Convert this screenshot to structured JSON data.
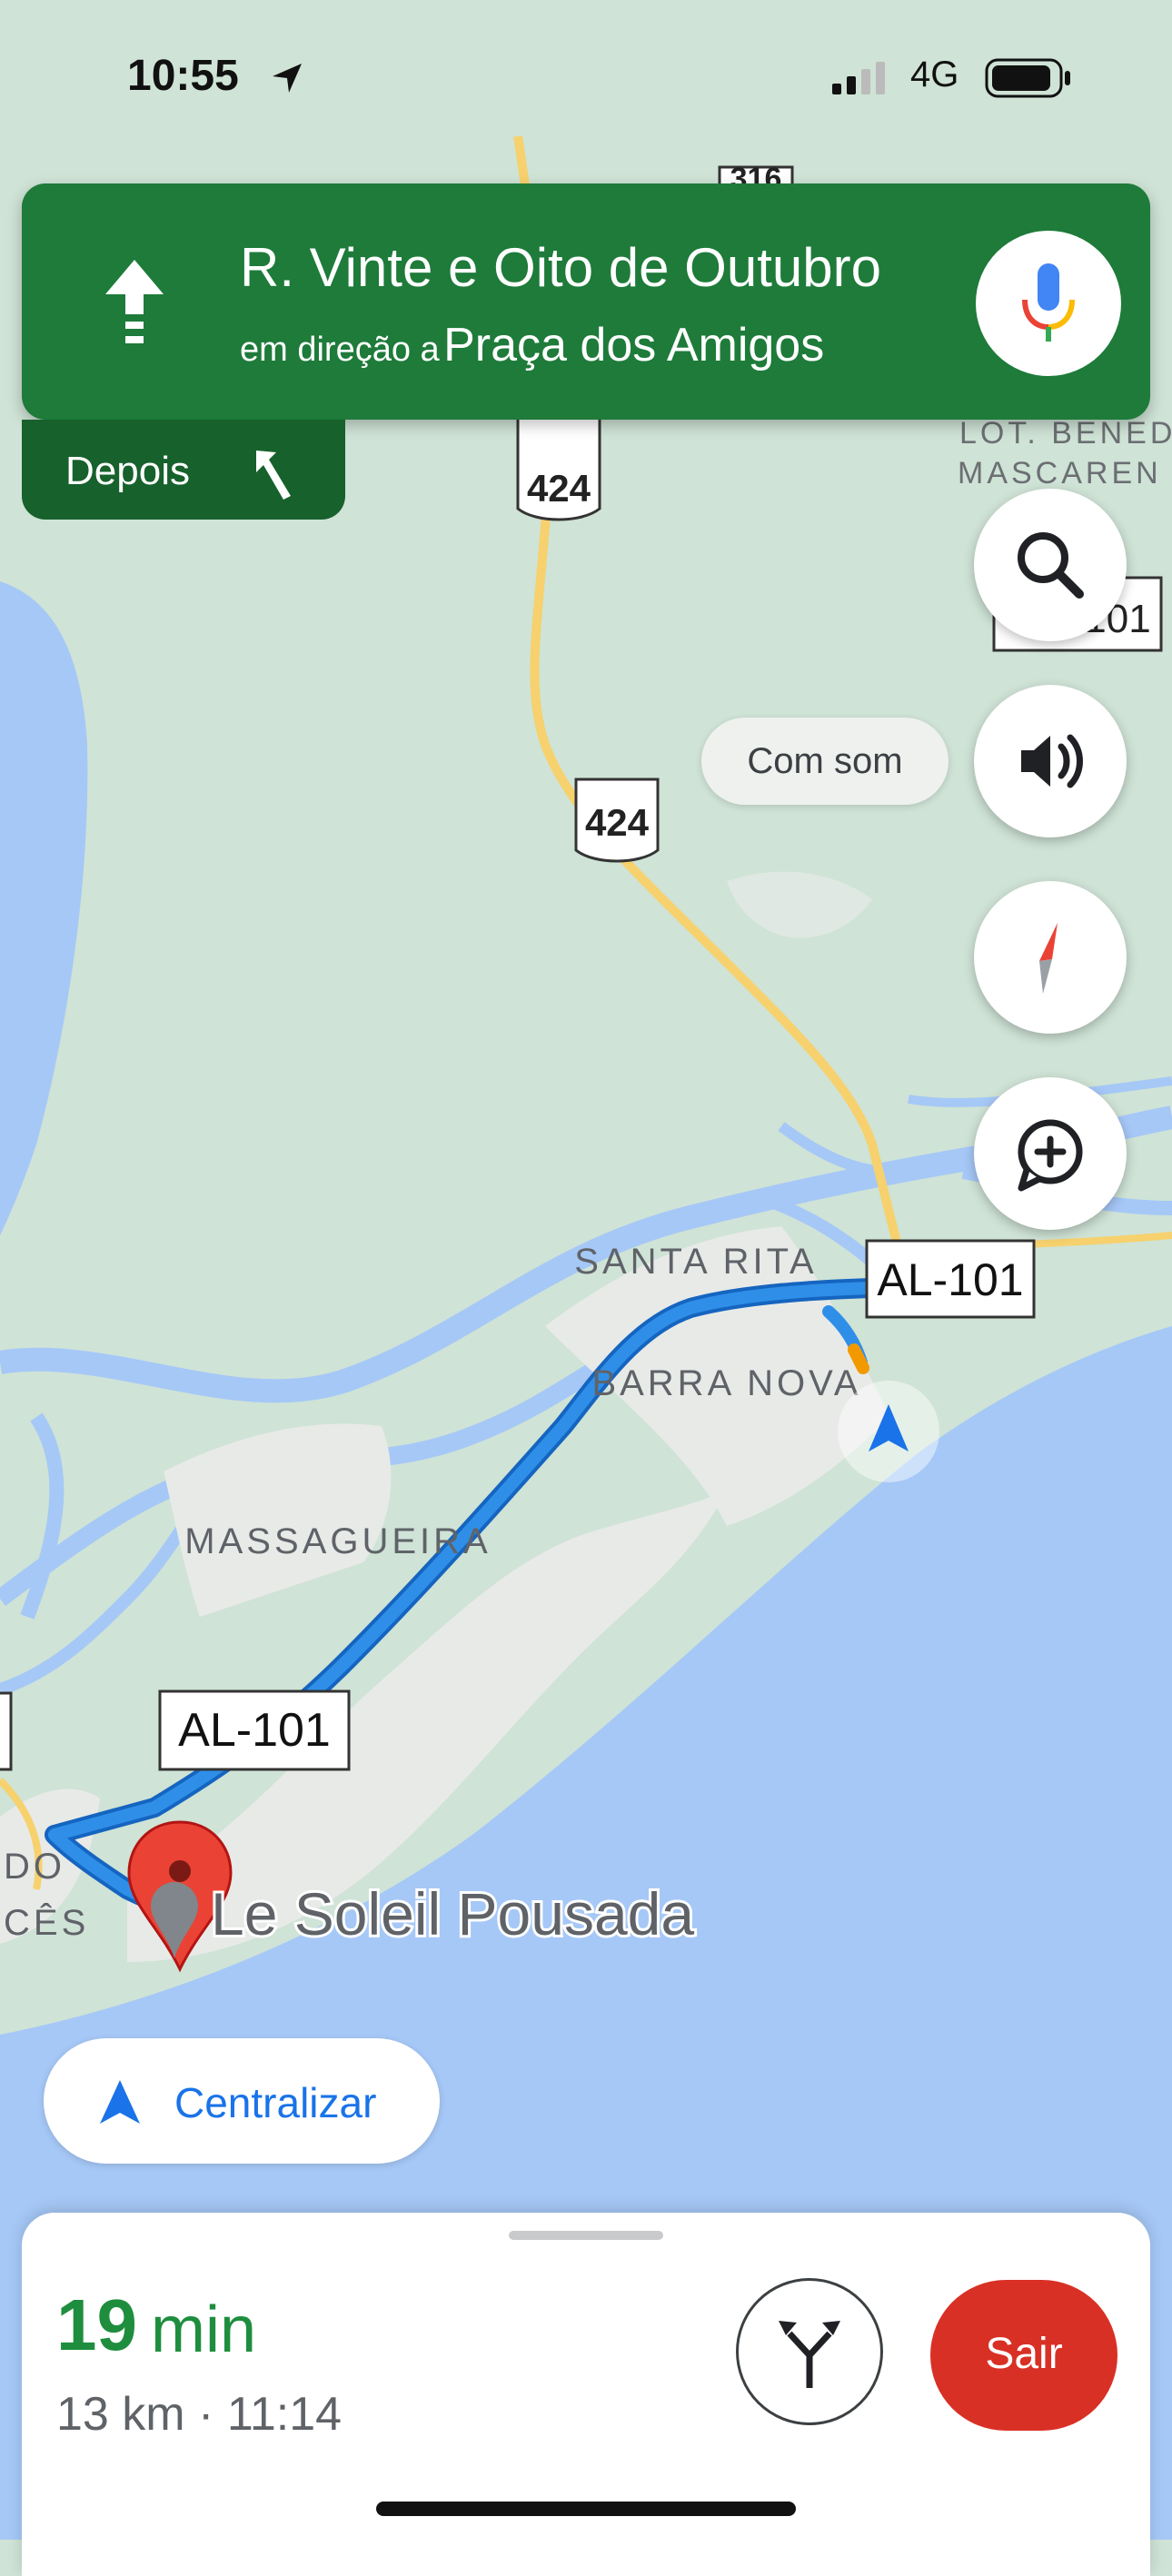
{
  "status_bar": {
    "time": "10:55",
    "network": "4G"
  },
  "navigation": {
    "street": "R. Vinte e Oito de Outubro",
    "toward_prefix": "em direção a",
    "toward_place": "Praça dos Amigos",
    "then_label": "Depois"
  },
  "map": {
    "road_labels": [
      "316",
      "424",
      "424",
      "101"
    ],
    "route_labels": [
      "AL-101",
      "AL-101"
    ],
    "places": [
      "SANTA RITA",
      "BARRA NOVA",
      "MASSAGUEIRA"
    ],
    "place_top_right": [
      "LOT. BENED",
      "MASCAREN"
    ],
    "place_left_edge": [
      "DO",
      "CÊS"
    ],
    "destination": "Le Soleil Pousada"
  },
  "controls": {
    "sound_label": "Com som",
    "recenter_label": "Centralizar"
  },
  "trip": {
    "duration_value": "19",
    "duration_unit": "min",
    "details": "13 km · 11:14",
    "exit_label": "Sair"
  },
  "colors": {
    "nav_green": "#1e7b3a",
    "route_blue": "#2f8fe8",
    "water": "#a6c8f7",
    "land": "#cfe3d6",
    "exit_red": "#d93025"
  }
}
